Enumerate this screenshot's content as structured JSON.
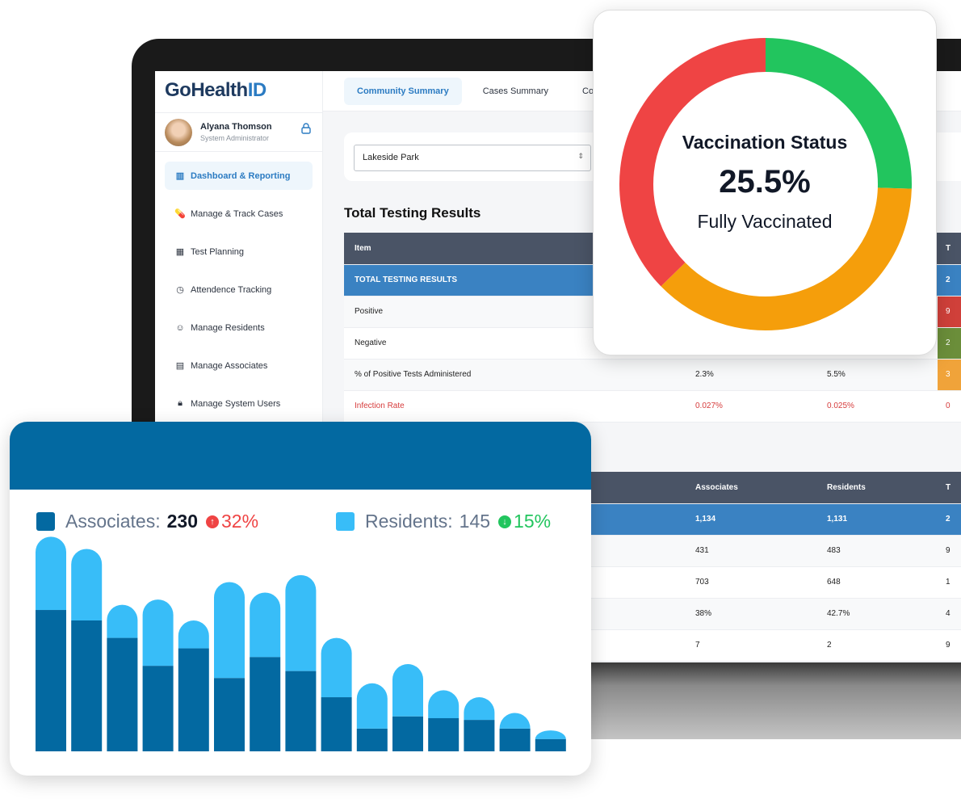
{
  "app": {
    "logo": "GoHealthID",
    "logo_prefix": "GoHealth",
    "logo_suffix": "ID"
  },
  "user": {
    "name": "Alyana Thomson",
    "role": "System Administrator"
  },
  "sidebar": {
    "items": [
      {
        "label": "Dashboard & Reporting",
        "icon": "bar-chart-icon",
        "active": true
      },
      {
        "label": "Manage & Track Cases",
        "icon": "pill-icon"
      },
      {
        "label": "Test Planning",
        "icon": "calculator-icon"
      },
      {
        "label": "Attendence Tracking",
        "icon": "clock-icon"
      },
      {
        "label": "Manage Residents",
        "icon": "user-circle-icon"
      },
      {
        "label": "Manage Associates",
        "icon": "briefcase-icon"
      },
      {
        "label": "Manage System Users",
        "icon": "lock-icon"
      }
    ]
  },
  "tabs": [
    {
      "label": "Community Summary",
      "active": true
    },
    {
      "label": "Cases Summary"
    },
    {
      "label": "Comm"
    }
  ],
  "filter": {
    "selected": "Lakeside Park"
  },
  "testing": {
    "title": "Total Testing Results",
    "headers": [
      "Item",
      "",
      "",
      "T"
    ],
    "rows": [
      [
        "TOTAL TESTING RESULTS",
        "",
        "",
        "2"
      ],
      [
        "Positive",
        "",
        "",
        "9"
      ],
      [
        "Negative",
        "",
        "",
        "2"
      ],
      [
        "% of Positive Tests Administered",
        "2.3%",
        "5.5%",
        "3"
      ],
      [
        "Infection Rate",
        "0.027%",
        "0.025%",
        "0"
      ]
    ]
  },
  "second_table": {
    "headers": [
      "",
      "Associates",
      "Residents",
      "T"
    ],
    "rows": [
      [
        "",
        "1,134",
        "1,131",
        "2"
      ],
      [
        "",
        "431",
        "483",
        "9"
      ],
      [
        "",
        "703",
        "648",
        "1"
      ],
      [
        "",
        "38%",
        "42.7%",
        "4"
      ],
      [
        "",
        "7",
        "2",
        "9"
      ]
    ]
  },
  "colors": {
    "positive_cell": "#d0403a",
    "negative_cell": "#6b8e3a",
    "percent_cell": "#f0a33a",
    "associates": "#0369a1",
    "residents": "#38bdf8",
    "up": "#ef4444",
    "down": "#22c55e"
  },
  "vaccination": {
    "title": "Vaccination Status",
    "value": "25.5%",
    "label": "Fully Vaccinated",
    "chart_data": {
      "type": "pie",
      "donut": true,
      "values": [
        25.5,
        37.2,
        37.3
      ],
      "colors": [
        "#22c55e",
        "#f59e0b",
        "#ef4444"
      ]
    }
  },
  "legend": {
    "associates": {
      "label": "Associates:",
      "value": "230",
      "change": "32%",
      "direction": "up"
    },
    "residents": {
      "label": "Residents:",
      "value": "145",
      "change": "15%",
      "direction": "down"
    }
  },
  "chart_data": {
    "type": "bar",
    "stacked": true,
    "ylim": [
      0,
      250
    ],
    "series": [
      {
        "name": "Associates",
        "values": [
          162,
          150,
          130,
          98,
          118,
          84,
          108,
          92,
          62,
          26,
          40,
          38,
          36,
          26,
          14
        ]
      },
      {
        "name": "Residents",
        "values": [
          84,
          82,
          38,
          76,
          32,
          110,
          74,
          110,
          68,
          52,
          60,
          32,
          26,
          18,
          10
        ]
      }
    ]
  }
}
